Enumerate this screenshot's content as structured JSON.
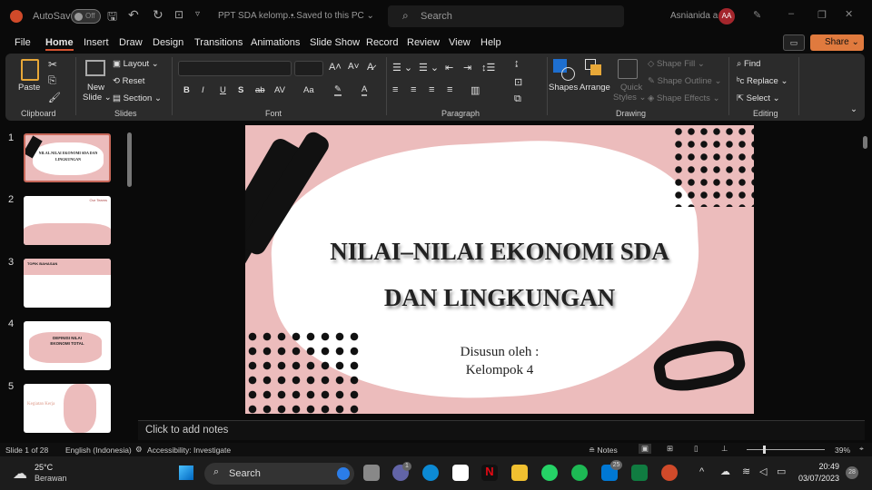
{
  "titlebar": {
    "autosave": "AutoSave",
    "autosave_state": "Off",
    "doc_title": "PPT SDA kelomp...",
    "save_state": "• Saved to this PC ⌄",
    "search_placeholder": "Search",
    "user_name": "Asnianida a",
    "avatar_initials": "AA"
  },
  "menu": {
    "tabs": [
      "File",
      "Home",
      "Insert",
      "Draw",
      "Design",
      "Transitions",
      "Animations",
      "Slide Show",
      "Record",
      "Review",
      "View",
      "Help"
    ],
    "active": "Home",
    "share": "Share"
  },
  "ribbon": {
    "clipboard": {
      "paste": "Paste",
      "label": "Clipboard"
    },
    "slides": {
      "new_slide_1": "New",
      "new_slide_2": "Slide ⌄",
      "layout": "Layout ⌄",
      "reset": "Reset",
      "section": "Section ⌄",
      "label": "Slides"
    },
    "font": {
      "label": "Font",
      "buttons": [
        "B",
        "I",
        "U",
        "S",
        "ab",
        "AV",
        "Aa"
      ]
    },
    "paragraph": {
      "label": "Paragraph"
    },
    "drawing": {
      "shapes": "Shapes",
      "arrange": "Arrange",
      "quick_styles_1": "Quick",
      "quick_styles_2": "Styles ⌄",
      "shape_fill": "Shape Fill ⌄",
      "shape_outline": "Shape Outline ⌄",
      "shape_effects": "Shape Effects ⌄",
      "label": "Drawing"
    },
    "editing": {
      "find": "Find",
      "replace": "Replace",
      "select": "Select ⌄",
      "label": "Editing"
    }
  },
  "thumbnails": [
    {
      "num": "1",
      "title": "NILAI–NILAI EKONOMI SDA DAN LINGKUNGAN"
    },
    {
      "num": "2",
      "title": "Our Teams"
    },
    {
      "num": "3",
      "title": "TOPIK BAHASAN"
    },
    {
      "num": "4",
      "title": "DEFINISI NILAI EKONOMI TOTAL"
    },
    {
      "num": "5",
      "title": "Kegiatan Kerja"
    }
  ],
  "slide": {
    "title_line1": "NILAI–NILAI EKONOMI SDA",
    "title_line2": "DAN LINGKUNGAN",
    "subtitle_line1": "Disusun oleh :",
    "subtitle_line2": "Kelompok 4",
    "colors": {
      "pink": "#ecbcbc",
      "white": "#ffffff",
      "black": "#111111"
    }
  },
  "notes": {
    "placeholder": "Click to add notes"
  },
  "status": {
    "slide": "Slide 1 of 28",
    "language": "English (Indonesia)",
    "accessibility": "Accessibility: Investigate",
    "notes": "Notes",
    "zoom": "39%"
  },
  "taskbar": {
    "temp": "25°C",
    "weather": "Berawan",
    "search": "Search",
    "teams_badge": "1",
    "outlook_badge": "25",
    "time": "20:49",
    "date": "03/07/2023",
    "notif": "28"
  }
}
